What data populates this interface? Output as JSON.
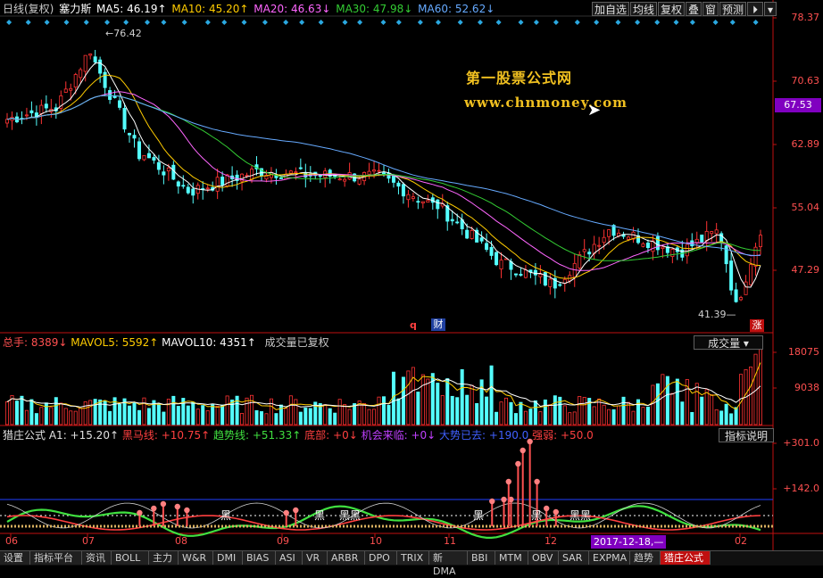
{
  "header": {
    "mode": "日线(复权)",
    "stock_name": "塞力斯",
    "ma5": "MA5: 46.19↑",
    "ma10": "MA10: 45.20↑",
    "ma20": "MA20: 46.63↓",
    "ma30": "MA30: 47.98↓",
    "ma60": "MA60: 52.62↓"
  },
  "toolbar": {
    "add_watch": "加自选",
    "ma_line": "均线",
    "restore": "复权",
    "overlay": "叠",
    "window": "窗",
    "forecast": "预测"
  },
  "colors": {
    "ma5": "#ffffff",
    "ma10": "#ffcc00",
    "ma20": "#ff66ff",
    "ma30": "#33cc33",
    "ma60": "#66aaff",
    "up": "#ff3333",
    "down": "#54ffff",
    "axis": "#c01010"
  },
  "price_axis": [
    "78.37",
    "70.63",
    "62.89",
    "55.04",
    "47.29"
  ],
  "current_price": "67.53",
  "price_marks": {
    "high": "76.42",
    "low": "41.39"
  },
  "badges": {
    "q": "q",
    "fin": "财",
    "zhang": "涨"
  },
  "watermark": {
    "line1": "第一股票公式网",
    "line2": "www.chnmoney.com"
  },
  "volume_panel": {
    "total": "总手: 8389↓",
    "mavol5": "MAVOL5: 5592↑",
    "mavol10": "MAVOL10: 4351↑",
    "note": "成交量已复权",
    "button": "成交量",
    "axis": [
      "18075",
      "9038"
    ]
  },
  "indicator_panel": {
    "name": "猎庄公式",
    "a1": "A1: +15.20↑",
    "heima": "黑马线: +10.75↑",
    "trend": "趋势线: +51.33↑",
    "bottom": "底部: +0↓",
    "chance": "机会来临: +0↓",
    "gone": "大势已去: +190.0",
    "strength": "强弱: +50.0",
    "button": "指标说明",
    "axis": [
      "+301.0",
      "+142.0"
    ],
    "labels": [
      "黑",
      "黑黑",
      "黑",
      "黑",
      "黑",
      "黑黑"
    ]
  },
  "x_axis": [
    "06",
    "07",
    "08",
    "09",
    "10",
    "11",
    "12",
    "02"
  ],
  "cursor_date": "2017-12-18,—",
  "tabs": [
    "设置",
    "指标平台",
    "资讯",
    "BOLL",
    "主力",
    "W&R",
    "DMI",
    "BIAS",
    "ASI",
    "VR",
    "ARBR",
    "DPO",
    "TRIX",
    "新DMA",
    "BBI",
    "MTM",
    "OBV",
    "SAR",
    "EXPMA",
    "趋势",
    "猎庄公式"
  ],
  "chart_data": {
    "type": "candlestick",
    "segments": [
      {
        "n": 10,
        "from": 66.5,
        "to": 68.0
      },
      {
        "n": 8,
        "from": 68.0,
        "to": 75.8
      },
      {
        "n": 10,
        "from": 74.0,
        "to": 61.8
      },
      {
        "n": 10,
        "from": 61.8,
        "to": 57.0
      },
      {
        "n": 14,
        "from": 57.0,
        "to": 59.6
      },
      {
        "n": 12,
        "from": 59.6,
        "to": 59.0
      },
      {
        "n": 12,
        "from": 59.0,
        "to": 58.9
      },
      {
        "n": 12,
        "from": 58.9,
        "to": 55.0
      },
      {
        "n": 14,
        "from": 55.0,
        "to": 47.2
      },
      {
        "n": 10,
        "from": 47.2,
        "to": 44.6
      },
      {
        "n": 12,
        "from": 44.6,
        "to": 51.8
      },
      {
        "n": 14,
        "from": 51.8,
        "to": 49.0
      },
      {
        "n": 8,
        "from": 49.0,
        "to": 51.5
      },
      {
        "n": 4,
        "from": 50.5,
        "to": 41.5
      },
      {
        "n": 5,
        "from": 43.5,
        "to": 51.9
      }
    ],
    "ylim": [
      40.2,
      80.0
    ],
    "volume_max": 18075
  }
}
